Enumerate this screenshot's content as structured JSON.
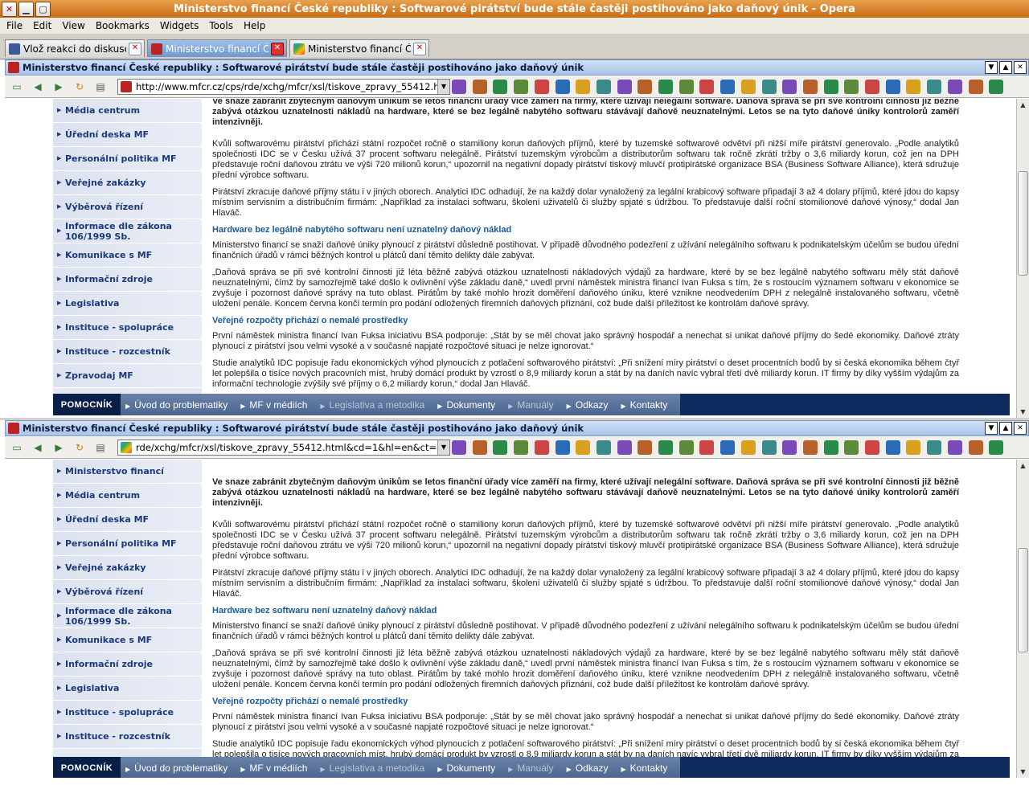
{
  "window": {
    "title": "Ministerstvo financí České republiky : Softwarové pirátství bude stále častěji postihováno jako daňový únik - Opera"
  },
  "menu": [
    "File",
    "Edit",
    "View",
    "Bookmarks",
    "Widgets",
    "Tools",
    "Help"
  ],
  "tabs": [
    {
      "label": "Vlož reakci do diskuse",
      "active": false
    },
    {
      "label": "Ministerstvo financí Če…",
      "active": true
    },
    {
      "label": "Ministerstvo financí Če…",
      "active": false
    }
  ],
  "panes": {
    "top": {
      "title": "Ministerstvo financí České republiky : Softwarové pirátství bude stále častěji postihováno jako daňový únik",
      "url": "http://www.mfcr.cz/cps/rde/xchg/mfcr/xsl/tiskove_zpravy_55412.html"
    },
    "bottom": {
      "title": "Ministerstvo financí České republiky : Softwarové pirátství bude stále častěji postihováno jako daňový únik",
      "url": "rde/xchg/mfcr/xsl/tiskove_zpravy_55412.html&cd=1&hl=en&ct=clnk"
    }
  },
  "sidebar_top": [
    "Média centrum",
    "Úřední deska MF",
    "Personální politika MF",
    "Veřejné zakázky",
    "Výběrová řízení",
    "Informace dle zákona 106/1999 Sb.",
    "Komunikace s MF",
    "Informační zdroje",
    "Legislativa",
    "Instituce - spolupráce",
    "Instituce - rozcestník",
    "Zpravodaj MF"
  ],
  "sidebar_bottom": [
    "Ministerstvo financí",
    "Média centrum",
    "Úřední deska MF",
    "Personální politika MF",
    "Veřejné zakázky",
    "Výběrová řízení",
    "Informace dle zákona 106/1999 Sb.",
    "Komunikace s MF",
    "Informační zdroje",
    "Legislativa",
    "Instituce - spolupráce",
    "Instituce - rozcestník"
  ],
  "article": {
    "lead": "Ve snaze zabránit zbytečným daňovým únikům se letos finanční úřady více zaměří na firmy, které užívají nelegální software. Daňová správa se při své kontrolní činnosti již běžně zabývá otázkou uznatelnosti nákladů na hardware, které se bez legálně nabytého softwaru stávávají daňově neuznatelnými. Letos se na tyto daňové úniky kontrolorů zaměří intenzivněji.",
    "p1": "Kvůli softwarovému pirátství přichází státní rozpočet ročně o stamiliony korun daňových příjmů, které by tuzemské softwarové odvětví při nižší míře pirátství generovalo. „Podle analytiků společnosti IDC se v Česku užívá 37 procent softwaru nelegálně. Pirátství tuzemským výrobcům a distributorům softwaru tak ročně zkrátí tržby o 3,6 miliardy korun, což jen na DPH představuje roční daňovou ztrátu ve výši 720 milionů korun,“ upozornil na negativní dopady pirátství tiskový mluvčí protipirátské organizace BSA (Business Software Alliance), která sdružuje přední výrobce softwaru.",
    "p2": "Pirátství zkracuje daňové příjmy státu i v jiných oborech. Analytici IDC odhadují, že na každý dolar vynaložený za legální krabicový software připadají 3 až 4 dolary příjmů, které jdou do kapsy místním servisním a distribučním firmám: „Například za instalaci softwaru, školení uživatelů či služby spjaté s údržbou. To představuje další roční stomilionové daňové výnosy,“ dodal Jan Hlaváč.",
    "h_top": "Hardware bez legálně nabytého softwaru není uznatelný daňový náklad",
    "h_bottom": "Hardware bez softwaru není uznatelný daňový náklad",
    "p3": "Ministerstvo financí se snaží daňové úniky plynoucí z pirátství důsledně postihovat. V případě důvodného podezření z užívání nelegálního softwaru k podnikatelským účelům se budou úřední finančních úřadů v rámci běžných kontrol u plátců daní těmito delikty dále zabývat.",
    "p4": "„Daňová správa se při své kontrolní činnosti již léta běžně zabývá otázkou uznatelnosti nákladových výdajů za hardware, které by se bez legálně nabytého softwaru měly stát daňově neuznatelnými, čímž by samozřejmě také došlo k ovlivnění výše základu daně,“ uvedl první náměstek ministra financí Ivan Fuksa s tím, že s rostoucím významem softwaru v ekonomice se zvyšuje i pozornost daňové správy na tuto oblast. Pirátům by také mohlo hrozit doměření daňového úniku, které vznikne neodvedením DPH z nelegálně instalovaného softwaru, včetně uložení penále. Koncem června končí termín pro podání odložených firemních daňových přiznání, což bude další příležitost ke kontrolám daňové správy.",
    "h2": "Veřejné rozpočty přichází o nemalé prostředky",
    "p5": "První náměstek ministra financí Ivan Fuksa iniciativu BSA podporuje: „Stát by se měl chovat jako správný hospodář a nenechat si unikat daňové příjmy do šedé ekonomiky. Daňové ztráty plynoucí z pirátství jsou velmi vysoké a v současné napjaté rozpočtové situaci je nelze ignorovat.“",
    "p6": "Studie analytiků IDC popisuje řadu ekonomických výhod plynoucích z potlačení softwarového pirátství: „Při snížení míry pirátství o deset procentních bodů by si česká ekonomika během čtyř let polepšila o tisíce nových pracovních míst, hrubý domácí produkt by vzrostl o 8,9 miliardy korun a stát by na daních navíc vybral třetí dvě miliardy korun. IT firmy by díky vyšším výdajům za informační technologie zvýšily své příjmy o 6,2 miliardy korun,“ dodal Jan Hlaváč."
  },
  "bottomnav": {
    "label": "POMOCNÍK",
    "items": [
      {
        "label": "Úvod do problematiky",
        "dim": false
      },
      {
        "label": "MF v médiích",
        "dim": false
      },
      {
        "label": "Legislativa a metodika",
        "dim": true
      },
      {
        "label": "Dokumenty",
        "dim": false
      },
      {
        "label": "Manuály",
        "dim": true
      },
      {
        "label": "Odkazy",
        "dim": false
      },
      {
        "label": "Kontakty",
        "dim": false
      }
    ]
  },
  "toolbar_icons": [
    "page-icon",
    "back-icon",
    "forward-icon",
    "reload-icon",
    "trash-icon",
    "bookmark-icon",
    "ladybug-icon",
    "window-icon",
    "bookmark-icon",
    "excel-icon",
    "opera-icon",
    "gear-icon",
    "bookmark-icon",
    "bookmark-icon",
    "badge-icon",
    "bookmark-icon",
    "grid-icon",
    "tag-icon",
    "bookmark-icon",
    "paypal-icon",
    "blogger-icon",
    "sun-icon",
    "chart-icon",
    "globe-icon",
    "bookmark-icon",
    "feather-icon",
    "earth-icon",
    "image-icon",
    "headphones-icon",
    "ubuntu-icon",
    "tv-icon",
    "bookmark-icon"
  ],
  "colors": {
    "accent": "#0f2a5c",
    "sidebar": "#e4e8f2",
    "heading": "#1a5a9a",
    "title_bar": "#d8861e"
  }
}
